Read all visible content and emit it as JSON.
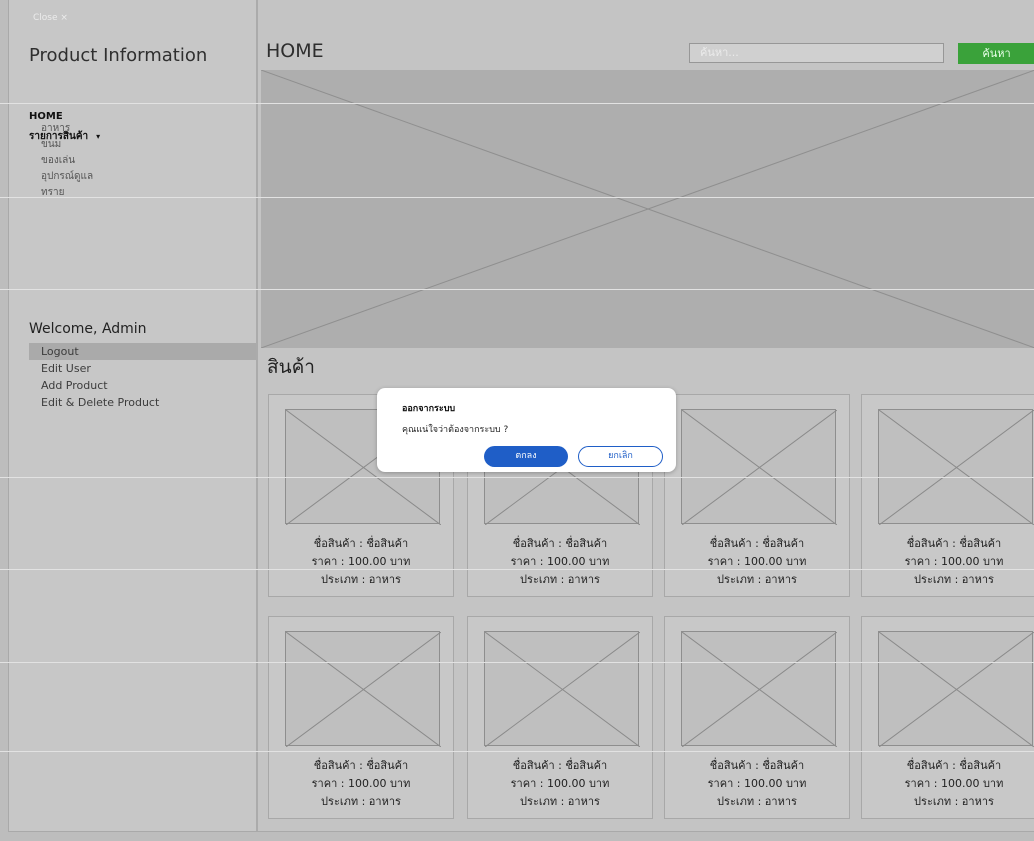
{
  "sidebar": {
    "close_label": "Close ×",
    "title": "Product Information",
    "nav": {
      "home": "HOME",
      "category": "รายการสินค้า",
      "caret": "▾"
    },
    "subcategories": [
      "อาหาร",
      "ขนม",
      "ของเล่น",
      "อุปกรณ์ดูแล",
      "ทราย"
    ],
    "welcome": "Welcome, Admin",
    "menu": [
      "Logout",
      "Edit User",
      "Add Product",
      "Edit & Delete Product"
    ]
  },
  "main": {
    "title": "HOME",
    "search_placeholder": "ค้นหา...",
    "search_button": "ค้นหา",
    "section_title": "สินค้า"
  },
  "products": [
    {
      "name": "ชื่อสินค้า : ชื่อสินค้า",
      "price": "ราคา : 100.00 บาท",
      "type": "ประเภท : อาหาร"
    },
    {
      "name": "ชื่อสินค้า : ชื่อสินค้า",
      "price": "ราคา : 100.00 บาท",
      "type": "ประเภท : อาหาร"
    },
    {
      "name": "ชื่อสินค้า : ชื่อสินค้า",
      "price": "ราคา : 100.00 บาท",
      "type": "ประเภท : อาหาร"
    },
    {
      "name": "ชื่อสินค้า : ชื่อสินค้า",
      "price": "ราคา : 100.00 บาท",
      "type": "ประเภท : อาหาร"
    },
    {
      "name": "ชื่อสินค้า : ชื่อสินค้า",
      "price": "ราคา : 100.00 บาท",
      "type": "ประเภท : อาหาร"
    },
    {
      "name": "ชื่อสินค้า : ชื่อสินค้า",
      "price": "ราคา : 100.00 บาท",
      "type": "ประเภท : อาหาร"
    },
    {
      "name": "ชื่อสินค้า : ชื่อสินค้า",
      "price": "ราคา : 100.00 บาท",
      "type": "ประเภท : อาหาร"
    },
    {
      "name": "ชื่อสินค้า : ชื่อสินค้า",
      "price": "ราคา : 100.00 บาท",
      "type": "ประเภท : อาหาร"
    }
  ],
  "modal": {
    "title": "ออกจากระบบ",
    "message": "คุณแน่ใจว่าต้องจากระบบ ?",
    "ok_label": "ตกลง",
    "cancel_label": "ยกเลิก"
  },
  "colors": {
    "search_button": "#3aa23a",
    "modal_primary": "#1f5ec7"
  }
}
